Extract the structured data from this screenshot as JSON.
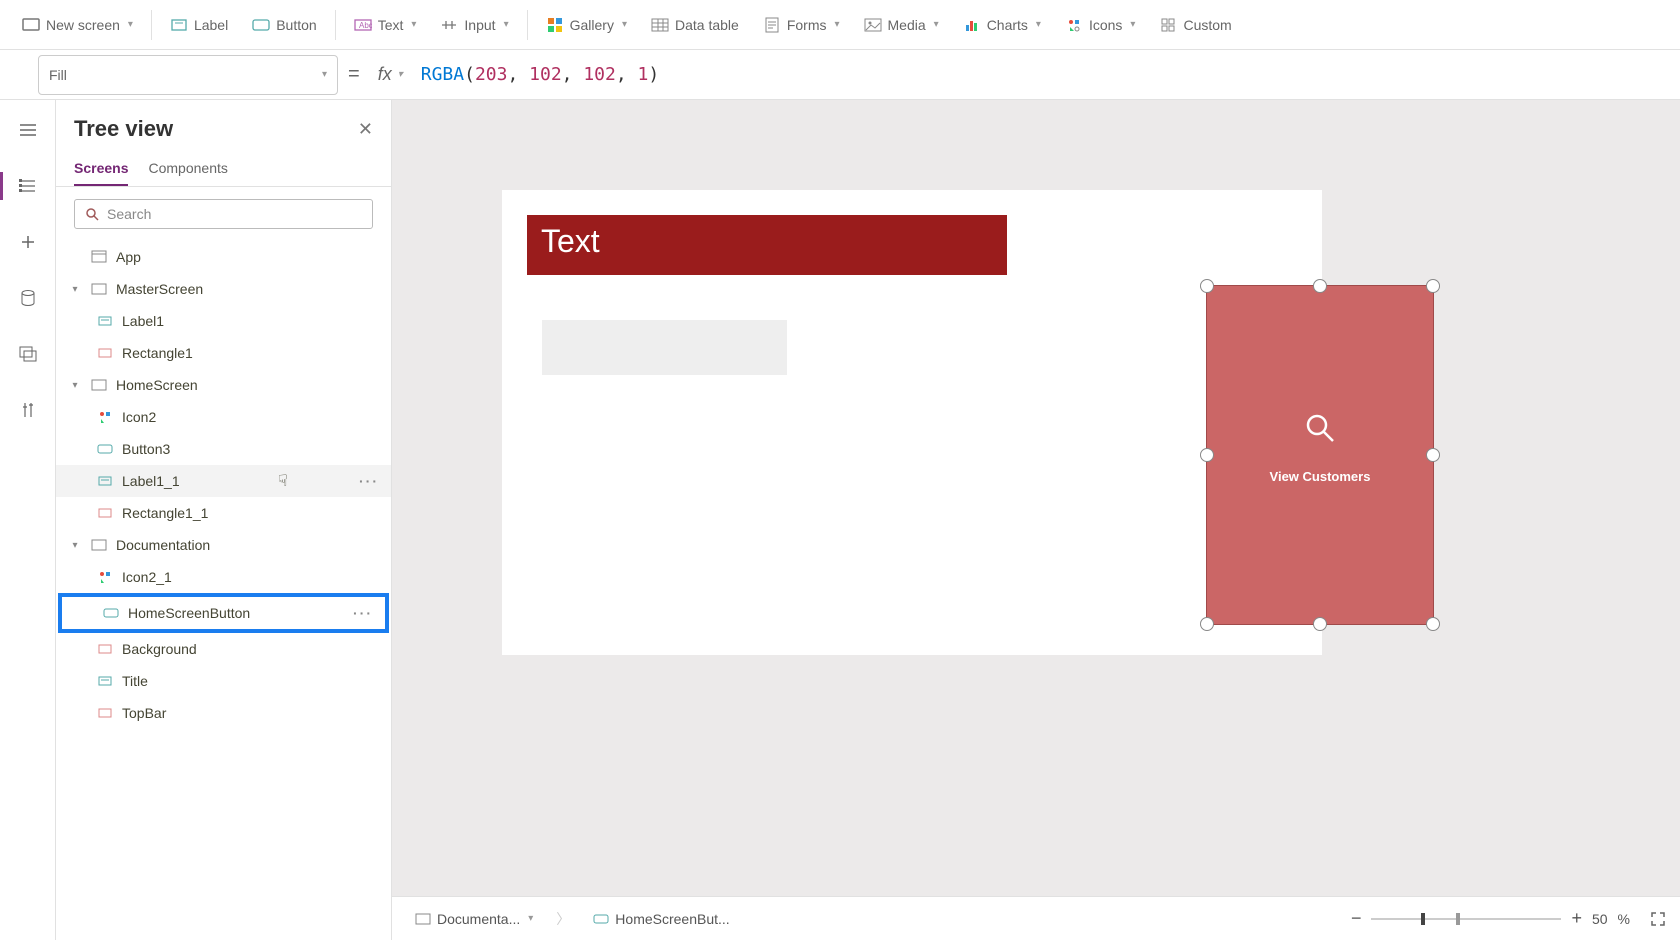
{
  "toolbar": {
    "new_screen": "New screen",
    "label": "Label",
    "button": "Button",
    "text": "Text",
    "input": "Input",
    "gallery": "Gallery",
    "data_table": "Data table",
    "forms": "Forms",
    "media": "Media",
    "charts": "Charts",
    "icons": "Icons",
    "custom": "Custom"
  },
  "formula": {
    "property": "Fill",
    "fn": "RGBA",
    "args": [
      "203",
      "102",
      "102",
      "1"
    ]
  },
  "tree": {
    "title": "Tree view",
    "tabs": {
      "screens": "Screens",
      "components": "Components"
    },
    "search_placeholder": "Search",
    "items": {
      "app": "App",
      "master": "MasterScreen",
      "label1": "Label1",
      "rect1": "Rectangle1",
      "home": "HomeScreen",
      "icon2": "Icon2",
      "button3": "Button3",
      "label1_1": "Label1_1",
      "rect1_1": "Rectangle1_1",
      "doc": "Documentation",
      "icon2_1": "Icon2_1",
      "homebtn": "HomeScreenButton",
      "background": "Background",
      "titlelbl": "Title",
      "topbar": "TopBar"
    }
  },
  "canvas": {
    "header_text": "Text",
    "button_label": "View Customers"
  },
  "status": {
    "crumb1": "Documenta...",
    "crumb2": "HomeScreenBut...",
    "zoom_pct": "50",
    "zoom_sym": "%"
  }
}
